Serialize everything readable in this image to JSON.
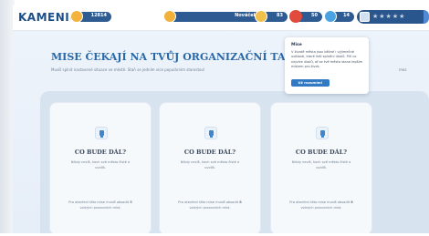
{
  "header": {
    "brand": "KAMENICE",
    "badges": [
      {
        "icon": "coin-icon",
        "value": "12814"
      },
      {
        "icon": "trophy-icon",
        "value": "Nováček"
      },
      {
        "icon": "smile-icon",
        "value": "83"
      },
      {
        "icon": "target-icon",
        "value": "50"
      },
      {
        "icon": "gem-icon",
        "value": "14"
      }
    ],
    "profile_stars": "★★★★★"
  },
  "main": {
    "title": "Mise čekají na tvůj organizační talent",
    "subtitle": "Musíš splnit nastavené situace ve městě. Staň se jedním více populárním starostou!",
    "subtitle_tail": "mez"
  },
  "cards": [
    {
      "icon": "lock-icon",
      "title": "Co bude dál?",
      "description": "Nikdy nevíš, hoch své město čisté a uvidíš.",
      "footer_pre": "Pro otevření této mise musíš obsadit",
      "footer_count": "5",
      "footer_post": "volných pracovních míst."
    },
    {
      "icon": "lock-icon",
      "title": "Co bude dál?",
      "description": "Nikdy nevíš, hoch své město čisté a uvidíš.",
      "footer_pre": "Pro otevření této mise musíš obsadit",
      "footer_count": "8",
      "footer_post": "volných pracovních míst."
    },
    {
      "icon": "lock-icon",
      "title": "Co bude dál?",
      "description": "Nikdy nevíš, hoch své město čisté a uvidíš.",
      "footer_pre": "Pro otevření této mise musíš obsadit",
      "footer_count": "8",
      "footer_post": "volných pracovních míst."
    }
  ],
  "tooltip": {
    "title": "Mise",
    "text": "V životě města jsou běžné i výjimečné události, které řeší splnění úkolů. Plň co nejvíce úkolů, ať se tvé město stane lepším místem pro život.",
    "button": "Už rozumím!"
  },
  "colors": {
    "brand": "#1c4e8a",
    "title": "#2868a8",
    "button": "#2f79c5"
  }
}
